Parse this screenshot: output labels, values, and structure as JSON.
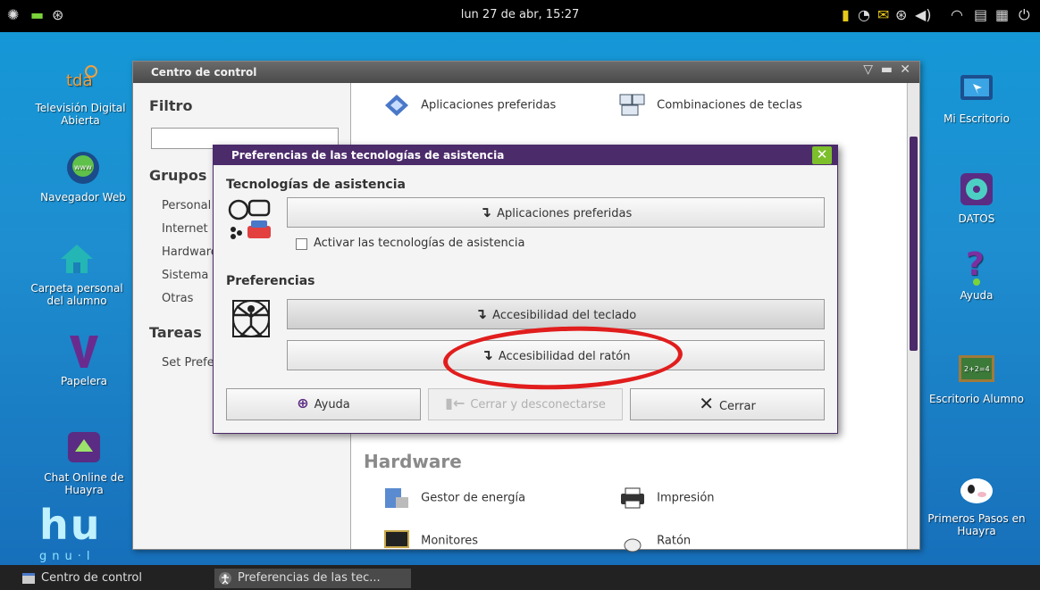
{
  "top_panel": {
    "clock": "lun 27 de abr, 15:27",
    "left_icons": [
      "huayra-menu-icon",
      "window-list-icon",
      "accessibility-icon"
    ],
    "right_icons": [
      "battery-icon",
      "notification-icon",
      "accessibility-icon",
      "volume-icon",
      "wifi-icon",
      "clipboard-icon",
      "screen-icon",
      "power-icon"
    ]
  },
  "desktop": {
    "left_icons": [
      {
        "label": "Televisión Digital Abierta",
        "icon": "tda-icon"
      },
      {
        "label": "Navegador Web",
        "icon": "browser-icon"
      },
      {
        "label": "Carpeta personal del alumno",
        "icon": "home-folder-icon"
      },
      {
        "label": "Papelera",
        "icon": "trash-icon"
      },
      {
        "label": "Chat Online de Huayra",
        "icon": "chat-icon"
      }
    ],
    "right_icons": [
      {
        "label": "Mi Escritorio",
        "icon": "monitor-icon"
      },
      {
        "label": "DATOS",
        "icon": "disk-icon"
      },
      {
        "label": "Ayuda",
        "icon": "help-icon"
      },
      {
        "label": "Escritorio Alumno",
        "icon": "chalkboard-icon"
      },
      {
        "label": "Primeros Pasos en Huayra",
        "icon": "cow-icon"
      }
    ],
    "logo": "hu",
    "logo_sub": "gnu·l"
  },
  "control_center": {
    "title": "Centro de control",
    "filter_label": "Filtro",
    "groups_label": "Grupos",
    "groups": [
      "Personal",
      "Internet",
      "Hardware",
      "Sistema",
      "Otras"
    ],
    "tasks_label": "Tareas",
    "tasks": [
      "Set Preferred"
    ],
    "items_top": [
      "Aplicaciones preferidas",
      "Combinaciones de teclas"
    ],
    "hardware_heading": "Hardware",
    "hardware_items": [
      "Gestor de energía",
      "Impresión",
      "Monitores",
      "Ratón"
    ]
  },
  "dialog": {
    "title": "Preferencias de las tecnologías de asistencia",
    "section_assistive": "Tecnologías de asistencia",
    "btn_preferred_apps": "Aplicaciones preferidas",
    "checkbox_label": "Activar las tecnologías de asistencia",
    "checkbox_checked": false,
    "section_prefs": "Preferencias",
    "btn_keyboard": "Accesibilidad del teclado",
    "btn_mouse": "Accesibilidad del ratón",
    "btn_help": "Ayuda",
    "btn_logout": "Cerrar y desconectarse",
    "btn_close": "Cerrar"
  },
  "taskbar": {
    "tasks": [
      "Centro de control",
      "Preferencias de las tec..."
    ]
  },
  "colors": {
    "dialog_title_bg": "#4c2b6b",
    "close_btn": "#7cbf2b",
    "annotation": "#e11d1d",
    "desktop": "#1e8ed0"
  }
}
